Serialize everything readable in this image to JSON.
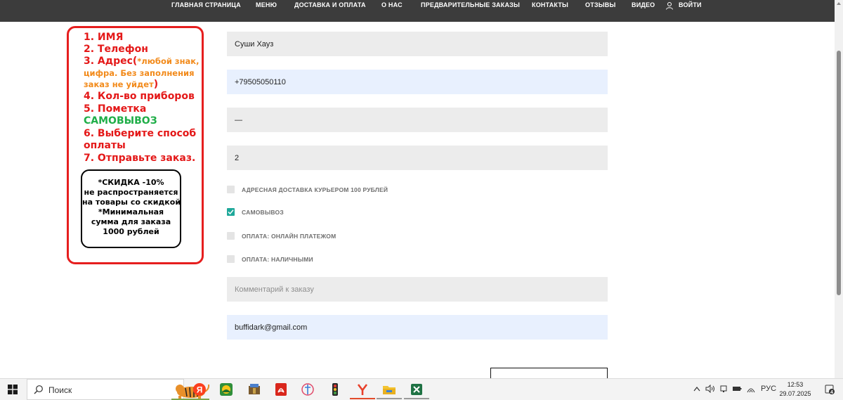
{
  "nav": {
    "items": [
      "ГЛАВНАЯ СТРАНИЦА",
      "МЕНЮ",
      "ДОСТАВКА И ОПЛАТА",
      "О НАС",
      "ПРЕДВАРИТЕЛЬНЫЕ ЗАКАЗЫ",
      "КОНТАКТЫ",
      "ОТЗЫВЫ",
      "ВИДЕО"
    ],
    "login": "ВОЙТИ",
    "login_icon": "user-icon"
  },
  "instructions": {
    "l1": "1. ИМЯ",
    "l2": "2. Телефон",
    "l3_start": "3. Адрес(",
    "l3_note1": "*любой знак,",
    "l3_note2": "цифра. Без заполнения",
    "l3_note3": "заказ не уйдет",
    "l3_end": ")",
    "l4": "4. Кол-во приборов",
    "l5": "5. Пометка",
    "l5_green": "САМОВЫВОЗ",
    "l6a": "6. Выберите способ",
    "l6b": "оплаты",
    "l7": "7. Отправьте заказ.",
    "note": [
      "*СКИДКА  -10%",
      "не распространяется",
      "на товары со скидкой",
      "*Минимальная",
      "сумма для заказа",
      "1000 рублей"
    ]
  },
  "form": {
    "name_value": "Суши Хауз",
    "phone_value": "+79505050110",
    "address_value": "—",
    "count_value": "2",
    "options": [
      {
        "label": "АДРЕСНАЯ ДОСТАВКА КУРЬЕРОМ 100 РУБЛЕЙ",
        "checked": false
      },
      {
        "label": "САМОВЫВОЗ",
        "checked": true
      },
      {
        "label": "ОПЛАТА: ОНЛАЙН ПЛАТЕЖОМ",
        "checked": false
      },
      {
        "label": "ОПЛАТА: НАЛИЧНЫМИ",
        "checked": false
      }
    ],
    "comment_placeholder": "Комментарий к заказу",
    "email_value": "buffidark@gmail.com"
  },
  "taskbar": {
    "search_placeholder": "Поиск",
    "apps": [
      "yandex-icon",
      "maps-icon",
      "archive-icon",
      "pdf-icon",
      "tool-icon",
      "traffic-light-icon",
      "yandex-browser-icon",
      "file-explorer-icon",
      "excel-icon"
    ],
    "lang": "РУС",
    "time": "12:53",
    "date": "29.07.2025",
    "notifications": "4",
    "accent": "#e24b2a"
  }
}
